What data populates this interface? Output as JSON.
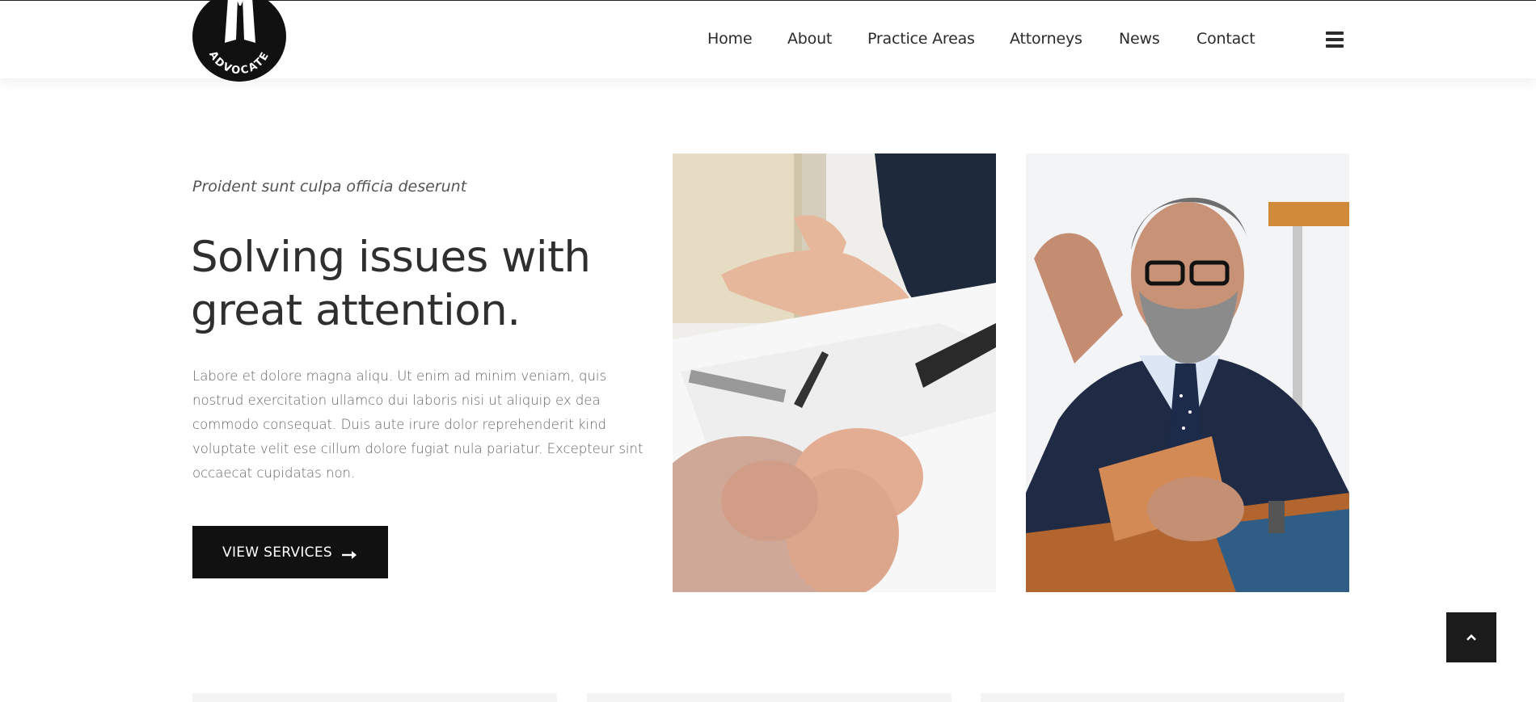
{
  "header": {
    "logo_text": "ADVOCATE",
    "nav": [
      {
        "label": "Home"
      },
      {
        "label": "About"
      },
      {
        "label": "Practice Areas"
      },
      {
        "label": "Attorneys"
      },
      {
        "label": "News"
      },
      {
        "label": "Contact"
      }
    ],
    "menu_icon": "hamburger-menu-icon"
  },
  "hero": {
    "eyebrow": "Proident sunt culpa officia deserunt",
    "headline_line1": "Solving issues with",
    "headline_line2": "great attention.",
    "body_lines": [
      "Labore et dolore magna aliqu. Ut enim ad minim veniam, quis",
      "nostrud exercitation ullamco dui laboris nisi ut aliquip ex dea",
      "commodo consequat. Duis aute irure dolor reprehenderit kind",
      "voluptate velit ese cillum dolore fugiat nula pariatur. Excepteur sint",
      "occaecat cupidatas non."
    ],
    "cta_label": "VIEW SERVICES",
    "cta_icon": "arrow-right-icon"
  },
  "images": [
    {
      "name": "handshake-meeting-photo"
    },
    {
      "name": "lawyer-reading-tablet-photo"
    }
  ],
  "back_to_top_icon": "chevron-up-icon",
  "colors": {
    "accent": "#111111",
    "text": "#2f2f2f",
    "muted": "#666666"
  }
}
